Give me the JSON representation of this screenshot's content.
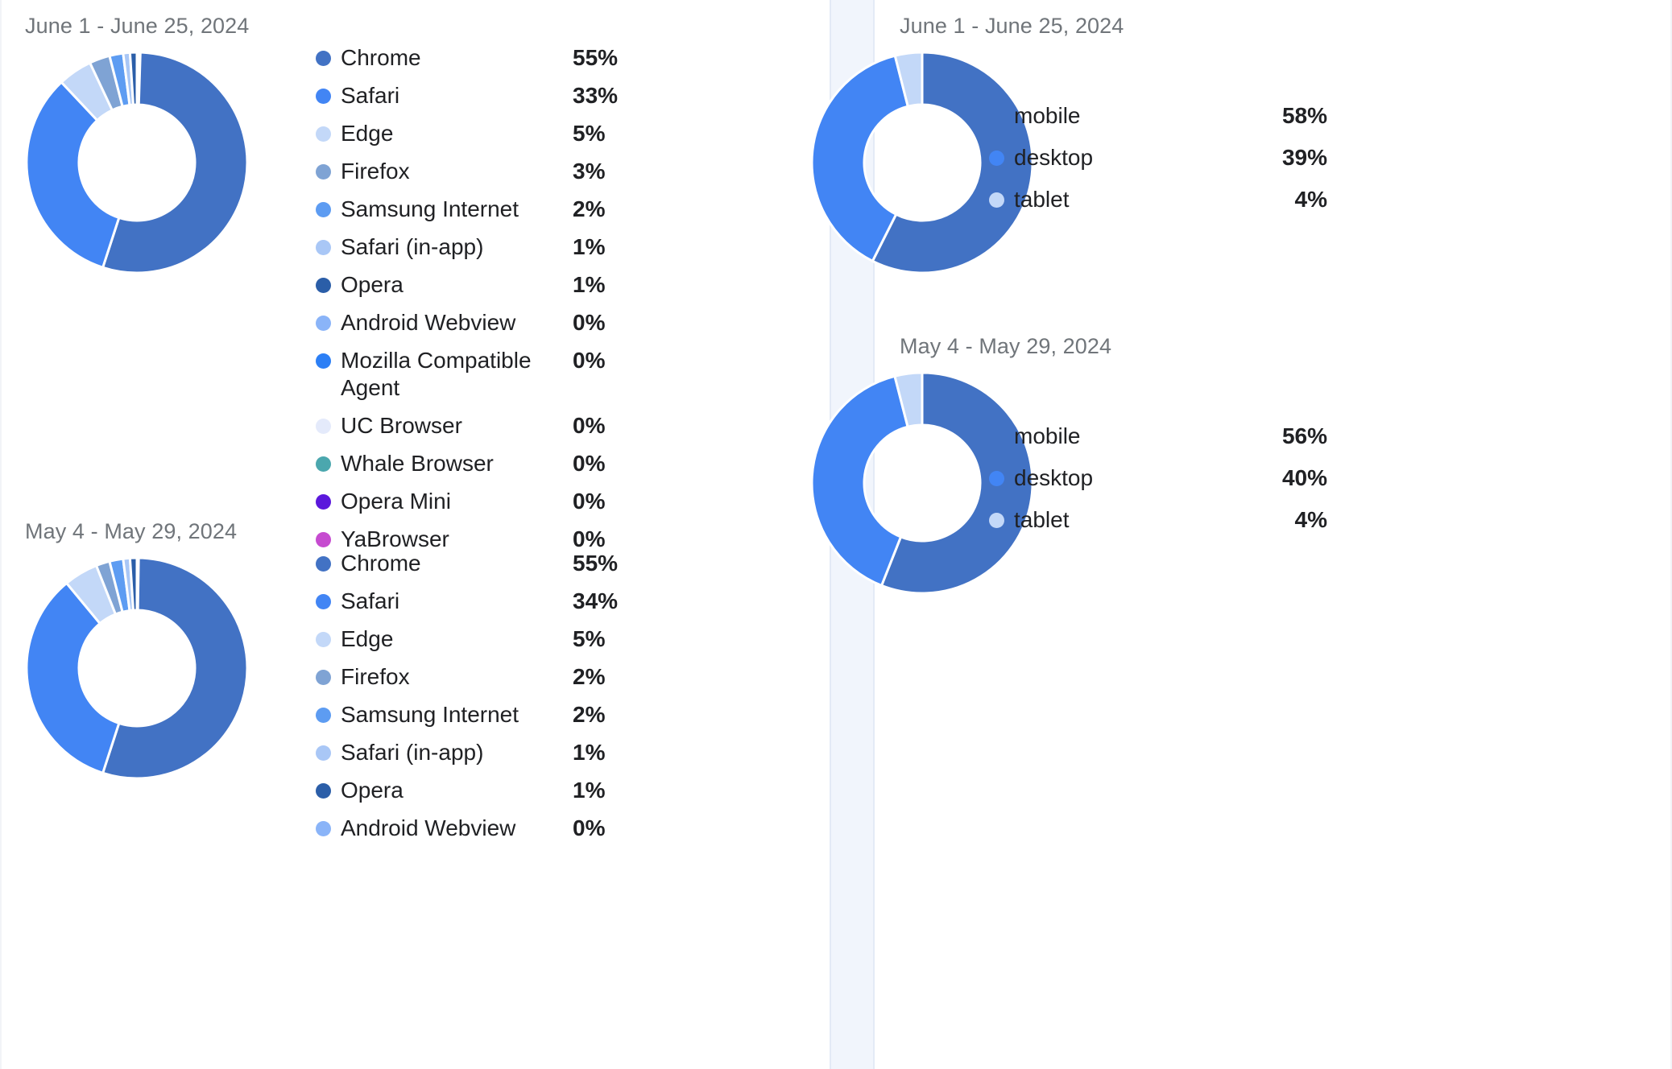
{
  "palette": {
    "chrome": "#4272c4",
    "safari": "#4285f4",
    "edge": "#c3d8f8",
    "firefox": "#7fa3d4",
    "samsung": "#5d9cf2",
    "safari_inapp": "#a9c7f6",
    "opera": "#2b5ea8",
    "android_webview": "#8ab4f8",
    "mozilla_agent": "#2c7ff5",
    "uc_browser": "#e4eafb",
    "whale": "#4ba7ae",
    "opera_mini": "#5b18dc",
    "yabrowser": "#c64bd0",
    "mobile": "#4272c4",
    "desktop": "#4285f4",
    "tablet": "#c3d8f8",
    "text_primary": "#202124",
    "text_muted": "#70757a",
    "divider_fill": "#f1f5fc",
    "divider_line": "#e3eaf6",
    "gap_stroke": "#ffffff"
  },
  "panels": {
    "browsers": {
      "charts": [
        {
          "title": "June 1 - June 25, 2024",
          "chart_data": {
            "type": "pie",
            "title": "June 1 - June 25, 2024",
            "legend_position": "right",
            "categories": [
              "Chrome",
              "Safari",
              "Edge",
              "Firefox",
              "Samsung Internet",
              "Safari (in-app)",
              "Opera",
              "Android Webview",
              "Mozilla Compatible Agent",
              "UC Browser",
              "Whale Browser",
              "Opera Mini",
              "YaBrowser"
            ],
            "values": [
              55,
              33,
              5,
              3,
              2,
              1,
              1,
              0,
              0,
              0,
              0,
              0,
              0
            ],
            "labels": [
              "55%",
              "33%",
              "5%",
              "3%",
              "2%",
              "1%",
              "1%",
              "0%",
              "0%",
              "0%",
              "0%",
              "0%",
              "0%"
            ],
            "colors": [
              "#4272c4",
              "#4285f4",
              "#c3d8f8",
              "#7fa3d4",
              "#5d9cf2",
              "#a9c7f6",
              "#2b5ea8",
              "#8ab4f8",
              "#2c7ff5",
              "#e4eafb",
              "#4ba7ae",
              "#5b18dc",
              "#c64bd0"
            ]
          }
        },
        {
          "title": "May 4 - May 29, 2024",
          "chart_data": {
            "type": "pie",
            "title": "May 4 - May 29, 2024",
            "legend_position": "right",
            "categories": [
              "Chrome",
              "Safari",
              "Edge",
              "Firefox",
              "Samsung Internet",
              "Safari (in-app)",
              "Opera",
              "Android Webview"
            ],
            "values": [
              55,
              34,
              5,
              2,
              2,
              1,
              1,
              0
            ],
            "labels": [
              "55%",
              "34%",
              "5%",
              "2%",
              "2%",
              "1%",
              "1%",
              "0%"
            ],
            "colors": [
              "#4272c4",
              "#4285f4",
              "#c3d8f8",
              "#7fa3d4",
              "#5d9cf2",
              "#a9c7f6",
              "#2b5ea8",
              "#8ab4f8"
            ]
          }
        }
      ]
    },
    "devices": {
      "charts": [
        {
          "title": "June 1 - June 25, 2024",
          "chart_data": {
            "type": "pie",
            "title": "June 1 - June 25, 2024",
            "legend_position": "right",
            "categories": [
              "mobile",
              "desktop",
              "tablet"
            ],
            "values": [
              58,
              39,
              4
            ],
            "labels": [
              "58%",
              "39%",
              "4%"
            ],
            "colors": [
              "#4272c4",
              "#4285f4",
              "#c3d8f8"
            ]
          }
        },
        {
          "title": "May 4 - May 29, 2024",
          "chart_data": {
            "type": "pie",
            "title": "May 4 - May 29, 2024",
            "legend_position": "right",
            "categories": [
              "mobile",
              "desktop",
              "tablet"
            ],
            "values": [
              56,
              40,
              4
            ],
            "labels": [
              "56%",
              "40%",
              "4%"
            ],
            "colors": [
              "#4272c4",
              "#4285f4",
              "#c3d8f8"
            ]
          }
        }
      ]
    }
  }
}
